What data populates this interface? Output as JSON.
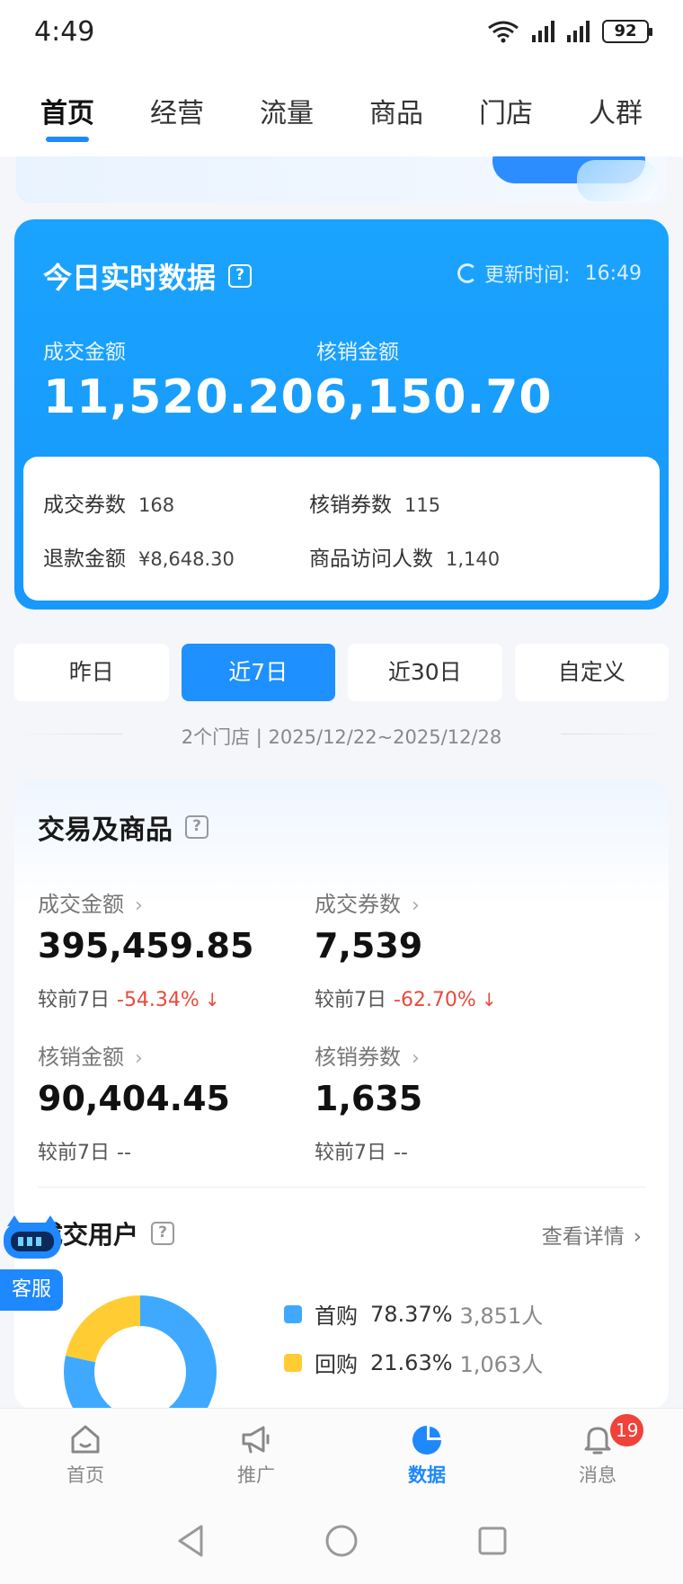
{
  "status_bar": {
    "time": "4:49",
    "battery": "92"
  },
  "top_tabs": [
    {
      "label": "首页",
      "active": true
    },
    {
      "label": "经营",
      "active": false
    },
    {
      "label": "流量",
      "active": false
    },
    {
      "label": "商品",
      "active": false
    },
    {
      "label": "门店",
      "active": false
    },
    {
      "label": "人群",
      "active": false
    }
  ],
  "realtime": {
    "title": "今日实时数据",
    "update_label": "更新时间:",
    "update_time": "16:49",
    "deal_amount_label": "成交金额",
    "deal_amount": "11,520.20",
    "verify_amount_label": "核销金额",
    "verify_amount": "6,150.70",
    "deal_coupons_label": "成交券数",
    "deal_coupons": "168",
    "verify_coupons_label": "核销券数",
    "verify_coupons": "115",
    "refund_label": "退款金额",
    "refund": "¥8,648.30",
    "visitors_label": "商品访问人数",
    "visitors": "1,140"
  },
  "periods": [
    {
      "label": "昨日",
      "active": false
    },
    {
      "label": "近7日",
      "active": true
    },
    {
      "label": "近30日",
      "active": false
    },
    {
      "label": "自定义",
      "active": false
    }
  ],
  "date_range": "2个门店 | 2025/12/22~2025/12/28",
  "trade": {
    "title": "交易及商品",
    "metrics": [
      {
        "label": "成交金额",
        "value": "395,459.85",
        "compare_label": "较前7日",
        "change": "-54.34%",
        "trend": "down"
      },
      {
        "label": "成交券数",
        "value": "7,539",
        "compare_label": "较前7日",
        "change": "-62.70%",
        "trend": "down"
      },
      {
        "label": "核销金额",
        "value": "90,404.45",
        "compare_label": "较前7日",
        "change": "--",
        "trend": "none"
      },
      {
        "label": "核销券数",
        "value": "1,635",
        "compare_label": "较前7日",
        "change": "--",
        "trend": "none"
      }
    ],
    "users_title": "成交用户",
    "view_detail": "查看详情",
    "user_split": [
      {
        "name": "首购",
        "pct": "78.37%",
        "count": "3,851人",
        "fraction": 0.7837,
        "color": "#3fa9ff"
      },
      {
        "name": "回购",
        "pct": "21.63%",
        "count": "1,063人",
        "fraction": 0.2163,
        "color": "#ffcc33"
      }
    ]
  },
  "customer_service": "客服",
  "bottom_nav": [
    {
      "label": "首页",
      "icon": "home-icon",
      "active": false
    },
    {
      "label": "推广",
      "icon": "megaphone-icon",
      "active": false
    },
    {
      "label": "数据",
      "icon": "pie-chart-icon",
      "active": true
    },
    {
      "label": "消息",
      "icon": "bell-icon",
      "active": false,
      "badge": "19"
    }
  ],
  "colors": {
    "primary": "#1e88ff",
    "card_blue": "#1aa3ff",
    "down_red": "#e84a3c",
    "badge_red": "#f0413a"
  }
}
